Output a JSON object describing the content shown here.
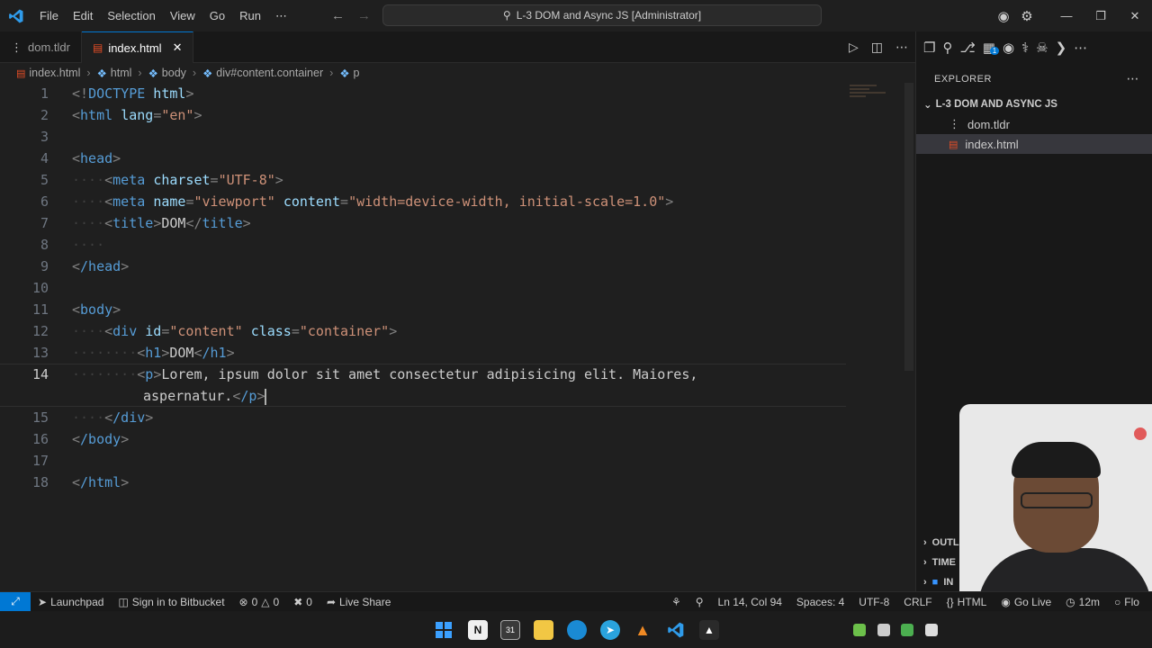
{
  "menu": [
    "File",
    "Edit",
    "Selection",
    "View",
    "Go",
    "Run",
    "⋯"
  ],
  "command_center": "L-3 DOM and Async JS [Administrator]",
  "tabs": [
    {
      "label": "dom.tldr",
      "active": false
    },
    {
      "label": "index.html",
      "active": true
    }
  ],
  "breadcrumb": [
    "index.html",
    "html",
    "body",
    "div#content.container",
    "p"
  ],
  "code": {
    "line_numbers": [
      "1",
      "2",
      "3",
      "4",
      "5",
      "6",
      "7",
      "8",
      "9",
      "10",
      "11",
      "12",
      "13",
      "14",
      "",
      "15",
      "16",
      "17",
      "18"
    ],
    "l1": {
      "open": "<!",
      "doctype": "DOCTYPE",
      "name": " html",
      "close": ">"
    },
    "l2": {
      "tag": "html",
      "attr": "lang",
      "val": "\"en\""
    },
    "l4": {
      "tag": "head"
    },
    "l5": {
      "tag": "meta",
      "attr": "charset",
      "val": "\"UTF-8\""
    },
    "l6": {
      "tag": "meta",
      "attr1": "name",
      "val1": "\"viewport\"",
      "attr2": "content",
      "val2": "\"width=device-width, initial-scale=1.0\""
    },
    "l7": {
      "tag": "title",
      "text": "DOM"
    },
    "l9": {
      "tag": "/head"
    },
    "l11": {
      "tag": "body"
    },
    "l12": {
      "tag": "div",
      "attr1": "id",
      "val1": "\"content\"",
      "attr2": "class",
      "val2": "\"container\""
    },
    "l13": {
      "tag": "h1",
      "text": "DOM",
      "ctag": "/h1"
    },
    "l14": {
      "tag": "p",
      "text": "Lorem, ipsum dolor sit amet consectetur adipisicing elit. Maiores,"
    },
    "l14b": {
      "text": "aspernatur.",
      "ctag": "/p"
    },
    "l15": {
      "tag": "/div"
    },
    "l16": {
      "tag": "/body"
    },
    "l18": {
      "tag": "/html"
    }
  },
  "sidebar": {
    "title": "EXPLORER",
    "folder": "L-3 DOM AND ASYNC JS",
    "files": [
      "dom.tldr",
      "index.html"
    ],
    "sections": [
      "OUTL",
      "TIME",
      "IN"
    ],
    "badge": "1"
  },
  "statusbar": {
    "launchpad": "Launchpad",
    "bitbucket": "Sign in to Bitbucket",
    "errors": "0",
    "warnings": "0",
    "ports": "0",
    "liveshare": "Live Share",
    "position": "Ln 14, Col 94",
    "spaces": "Spaces: 4",
    "encoding": "UTF-8",
    "eol": "CRLF",
    "language": "HTML",
    "golive": "Go Live",
    "time": "12m",
    "flow": "Flo"
  },
  "colors": {
    "accent": "#0078d4",
    "tag": "#569cd6",
    "attr": "#9cdcfe",
    "value": "#ce9178"
  }
}
